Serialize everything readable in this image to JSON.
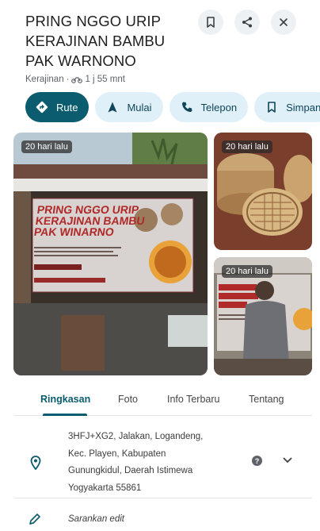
{
  "place": {
    "name": "PRING NGGO URIP KERAJINAN BAMBU PAK WARNONO",
    "category": "Kerajinan",
    "travel_time": "1 j 55 mnt",
    "separator": "·"
  },
  "actions": [
    {
      "label": "Rute",
      "icon": "directions-icon"
    },
    {
      "label": "Mulai",
      "icon": "navigation-arrow-icon"
    },
    {
      "label": "Telepon",
      "icon": "phone-icon"
    },
    {
      "label": "Simpan",
      "icon": "bookmark-icon"
    }
  ],
  "photos": [
    {
      "badge": "20 hari lalu"
    },
    {
      "badge": "20 hari lalu"
    },
    {
      "badge": "20 hari lalu"
    }
  ],
  "banner": {
    "line1": "PRING NGGO URIP",
    "line2": "KERAJINAN BAMBU",
    "line3": "PAK WINARNO"
  },
  "tabs": [
    "Ringkasan",
    "Foto",
    "Info Terbaru",
    "Tentang"
  ],
  "address": {
    "lines": [
      "3HFJ+XG2, Jalakan, Logandeng,",
      "Kec. Playen, Kabupaten",
      "Gunungkidul, Daerah Istimewa",
      "Yogyakarta 55861"
    ]
  },
  "edit": {
    "label": "Sarankan edit"
  },
  "colors": {
    "accent": "#0a5c6e",
    "chip_bg": "#dff0f8"
  }
}
